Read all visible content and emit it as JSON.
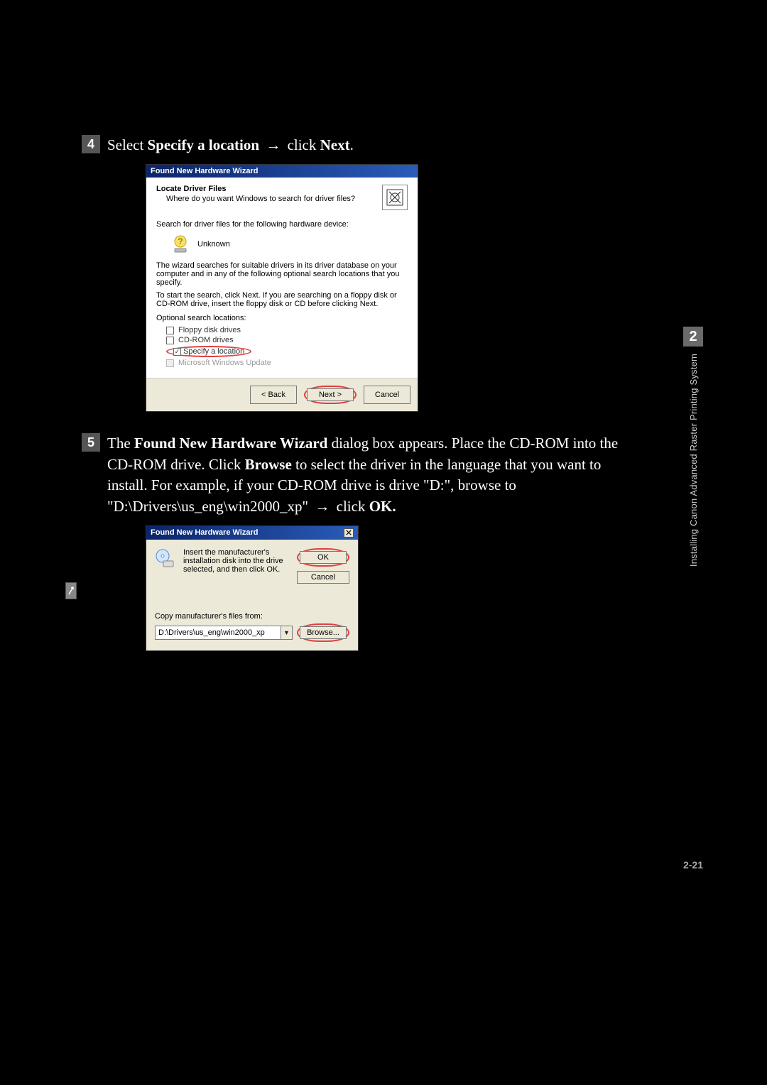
{
  "steps": {
    "s4_num": "4",
    "s4_pre": "Select ",
    "s4_bold1": "Specify a location",
    "s4_mid": " ",
    "s4_arrow": "→",
    "s4_mid2": " click ",
    "s4_bold2": "Next",
    "s4_end": ".",
    "s5_num": "5",
    "s5_pre": "The ",
    "s5_bold1": "Found New Hardware Wizard",
    "s5_t1": " dialog box appears. Place the CD-ROM into the CD-ROM drive. Click ",
    "s5_bold2": "Browse",
    "s5_t2": " to select the driver in the language that you want to install. For example, if your CD-ROM drive is drive \"D:\", browse to \"D:\\Drivers\\us_eng\\win2000_xp\" ",
    "s5_arrow": "→",
    "s5_t3": " click ",
    "s5_bold3": "OK.",
    "s5_end": ""
  },
  "dlg1": {
    "title": "Found New Hardware Wizard",
    "header_bold": "Locate Driver Files",
    "header_sub": "Where do you want Windows to search for driver files?",
    "search_for": "Search for driver files for the following hardware device:",
    "device_name": "Unknown",
    "para1": "The wizard searches for suitable drivers in its driver database on your computer and in any of the following optional search locations that you specify.",
    "para2": "To start the search, click Next. If you are searching on a floppy disk or CD-ROM drive, insert the floppy disk or CD before clicking Next.",
    "opt_label": "Optional search locations:",
    "options": {
      "floppy": "Floppy disk drives",
      "cdrom": "CD-ROM drives",
      "specify": "Specify a location",
      "msupdate": "Microsoft Windows Update"
    },
    "checked": {
      "floppy": false,
      "cdrom": false,
      "specify": true,
      "msupdate": false
    },
    "buttons": {
      "back": "< Back",
      "next": "Next >",
      "cancel": "Cancel"
    }
  },
  "dlg2": {
    "title": "Found New Hardware Wizard",
    "instruction": "Insert the manufacturer's installation disk into the drive selected, and then click OK.",
    "ok": "OK",
    "cancel": "Cancel",
    "copy_from": "Copy manufacturer's files from:",
    "path": "D:\\Drivers\\us_eng\\win2000_xp",
    "browse": "Browse..."
  },
  "sidebar": {
    "chapter": "2",
    "label": "Installing Canon Advanced Raster Printing System"
  },
  "page_number": "2-21"
}
